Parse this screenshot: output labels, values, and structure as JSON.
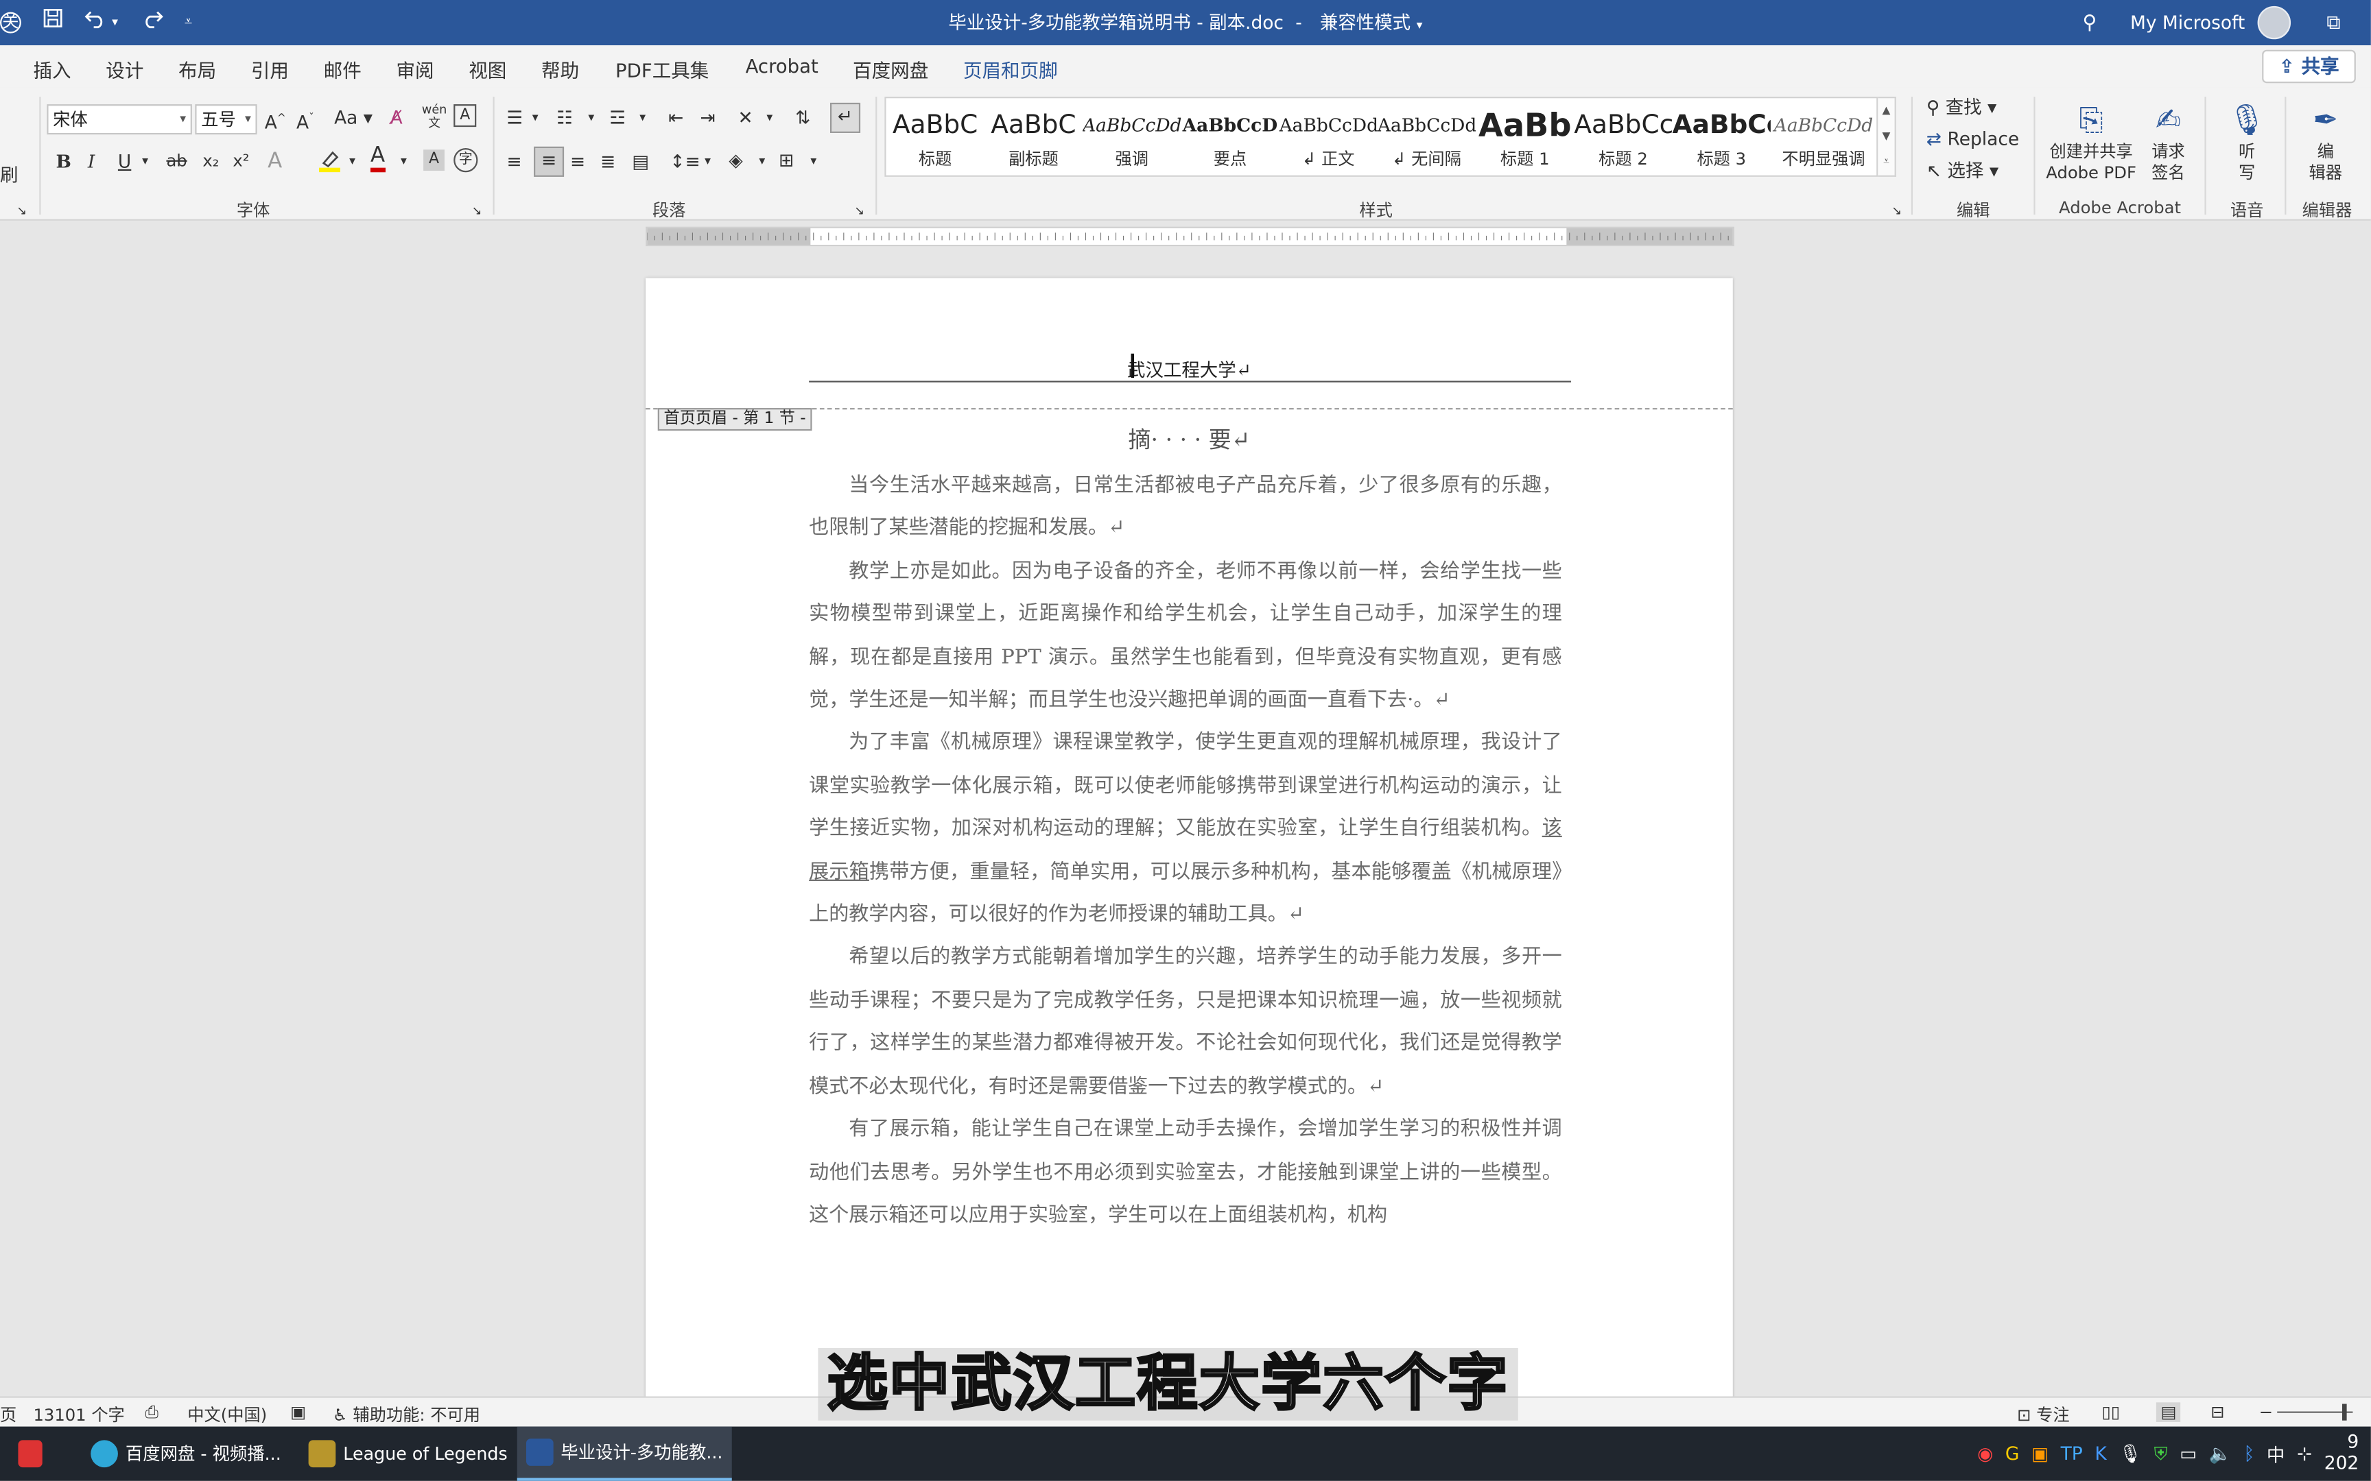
{
  "titlebar": {
    "title": "毕业设计-多功能教学箱说明书 - 副本.doc",
    "separator": "-",
    "compat_mode": "兼容性模式",
    "account": "My Microsoft",
    "qat_close": "关",
    "save_icon": "save-icon",
    "undo_icon": "undo-icon",
    "redo_icon": "redo-icon"
  },
  "tabs": [
    {
      "label": "插入"
    },
    {
      "label": "设计"
    },
    {
      "label": "布局"
    },
    {
      "label": "引用"
    },
    {
      "label": "邮件"
    },
    {
      "label": "审阅"
    },
    {
      "label": "视图"
    },
    {
      "label": "帮助"
    },
    {
      "label": "PDF工具集"
    },
    {
      "label": "Acrobat"
    },
    {
      "label": "百度网盘"
    },
    {
      "label": "页眉和页脚"
    }
  ],
  "share_label": "共享",
  "ribbon": {
    "clipboard_partial": "刷",
    "font": {
      "name": "宋体",
      "size": "五号",
      "grow": "A",
      "shrink": "A",
      "case": "Aa",
      "bold": "B",
      "italic": "I",
      "underline": "U",
      "strike": "ab",
      "sub": "x₂",
      "sup": "x²",
      "group_label": "字体"
    },
    "paragraph": {
      "group_label": "段落"
    },
    "styles": {
      "group_label": "样式",
      "items": [
        {
          "preview": "AaBbC",
          "name": "标题"
        },
        {
          "preview": "AaBbC",
          "name": "副标题"
        },
        {
          "preview": "AaBbCcDd",
          "name": "强调"
        },
        {
          "preview": "AaBbCcD",
          "name": "要点"
        },
        {
          "preview": "AaBbCcDd",
          "name": "↲ 正文"
        },
        {
          "preview": "AaBbCcDd",
          "name": "↲ 无间隔"
        },
        {
          "preview": "AaBb",
          "name": "标题 1"
        },
        {
          "preview": "AaBbCc",
          "name": "标题 2"
        },
        {
          "preview": "AaBbCc",
          "name": "标题 3"
        },
        {
          "preview": "AaBbCcDd",
          "name": "不明显强调"
        }
      ]
    },
    "editing": {
      "find": "查找",
      "replace": "Replace",
      "select": "选择",
      "group_label": "编辑"
    },
    "acrobat": {
      "create_share_1": "创建并共享",
      "create_share_2": "Adobe PDF",
      "request_sign_1": "请求",
      "request_sign_2": "签名",
      "group_label": "Adobe Acrobat"
    },
    "voice": {
      "dictate_1": "听",
      "dictate_2": "写",
      "group_label": "语音"
    },
    "editor": {
      "editor_1": "编",
      "editor_2": "辑器",
      "group_label": "编辑器"
    }
  },
  "document": {
    "header_text": "武汉工程大学↵",
    "header_tag": "首页页眉 - 第 1 节 -",
    "abstract_title": "摘· · · · 要↵",
    "paragraphs": [
      {
        "text": "当今生活水平越来越高，日常生活都被电子产品充斥着，少了很多原有的乐趣，也限制了某些潜能的挖掘和发展。↵"
      },
      {
        "text": "教学上亦是如此。因为电子设备的齐全，老师不再像以前一样，会给学生找一些实物模型带到课堂上，近距离操作和给学生机会，让学生自己动手，加深学生的理解，现在都是直接用 PPT 演示。虽然学生也能看到，但毕竟没有实物直观，更有感觉，学生还是一知半解；而且学生也没兴趣把单调的画面一直看下去·。↵"
      },
      {
        "before": "为了丰富《机械原理》课程课堂教学，使学生更直观的理解机械原理，我设计了课堂实验教学一体化展示箱，既可以使老师能够携带到课堂进行机构运动的演示，让学生接近实物，加深对机构运动的理解；又能放在实验室，让学生自行组装机构。",
        "underlined": "该展示箱",
        "after": "携带方便，重量轻，简单实用，可以展示多种机构，基本能够覆盖《机械原理》上的教学内容，可以很好的作为老师授课的辅助工具。↵"
      },
      {
        "text": "希望以后的教学方式能朝着增加学生的兴趣，培养学生的动手能力发展，多开一些动手课程；不要只是为了完成教学任务，只是把课本知识梳理一遍，放一些视频就行了，这样学生的某些潜力都难得被开发。不论社会如何现代化，我们还是觉得教学模式不必太现代化，有时还是需要借鉴一下过去的教学模式的。↵"
      },
      {
        "text": "有了展示箱，能让学生自己在课堂上动手去操作，会增加学生学习的积极性并调动他们去思考。另外学生也不用必须到实验室去，才能接触到课堂上讲的一些模型。这个展示箱还可以应用于实验室，学生可以在上面组装机构，机构"
      }
    ]
  },
  "subtitle": "选中武汉工程大学六个字",
  "statusbar": {
    "page_partial": "页",
    "word_count": "13101 个字",
    "language": "中文(中国)",
    "accessibility": "辅助功能: 不可用",
    "focus": "专注"
  },
  "taskbar": {
    "apps": [
      {
        "label": "百度网盘 - 视频播..."
      },
      {
        "label": "League of Legends"
      },
      {
        "label": "毕业设计-多功能教..."
      }
    ],
    "ime": "中",
    "time_partial": "9",
    "date_partial": "202"
  },
  "colors": {
    "titlebar": "#2b579a",
    "ribbon": "#f3f3f3",
    "taskbar": "#20262e",
    "body_text": "#6b6b6b"
  }
}
